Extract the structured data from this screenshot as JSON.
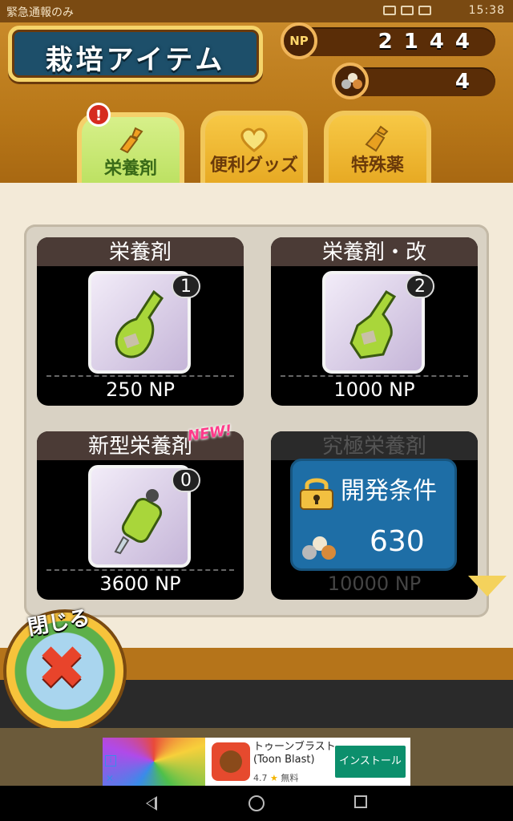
{
  "status_bar": {
    "left_text": "緊急通報のみ",
    "time": "15:38"
  },
  "header": {
    "title": "栽培アイテム",
    "np_badge": "NP",
    "np_value": "2144",
    "seed_value": "4"
  },
  "tabs": [
    {
      "label": "栄養剤",
      "active": true,
      "alert": "!"
    },
    {
      "label": "便利グッズ",
      "active": false
    },
    {
      "label": "特殊薬",
      "active": false
    }
  ],
  "items": [
    {
      "name": "栄養剤",
      "count": "1",
      "price": "250 NP"
    },
    {
      "name": "栄養剤・改",
      "count": "2",
      "price": "1000 NP"
    },
    {
      "name": "新型栄養剤",
      "count": "0",
      "price": "3600 NP",
      "tag": "NEW!"
    },
    {
      "name": "究極栄養剤",
      "price": "10000 NP",
      "locked": true,
      "lock_title": "開発条件",
      "lock_requirement": "630"
    }
  ],
  "close_button": {
    "label": "閉じる"
  },
  "ad": {
    "app_name": "トゥーンブラスト (Toon Blast)",
    "rating": "4.7",
    "star": "★",
    "price_text": "無料",
    "install_label": "インストール",
    "info_icon": "i",
    "close_icon": "✕"
  },
  "colors": {
    "accent_green": "#b7de5a",
    "header_brown": "#b87718",
    "lock_blue": "#1e6ea6",
    "close_red": "#e8442b"
  }
}
